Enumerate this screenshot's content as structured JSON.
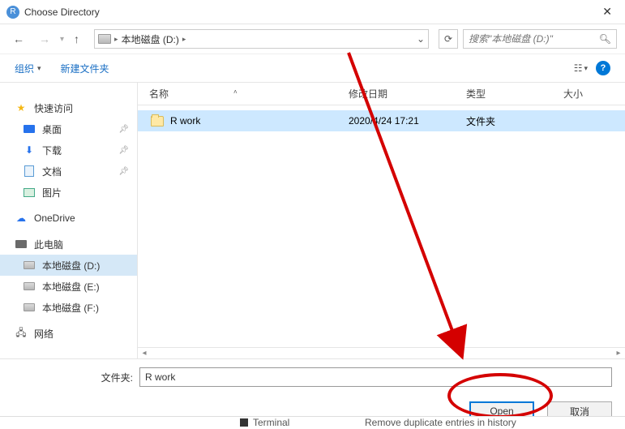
{
  "title": "Choose Directory",
  "breadcrumb": {
    "drive_label": "本地磁盘 (D:)"
  },
  "search": {
    "placeholder": "搜索\"本地磁盘 (D:)\""
  },
  "toolbar": {
    "organize": "组织",
    "newfolder": "新建文件夹"
  },
  "columns": {
    "name": "名称",
    "date": "修改日期",
    "type": "类型",
    "size": "大小"
  },
  "sidebar": {
    "quick": "快速访问",
    "desktop": "桌面",
    "downloads": "下载",
    "documents": "文档",
    "pictures": "图片",
    "onedrive": "OneDrive",
    "thispc": "此电脑",
    "drive_d": "本地磁盘 (D:)",
    "drive_e": "本地磁盘 (E:)",
    "drive_f": "本地磁盘 (F:)",
    "network": "网络"
  },
  "rows": [
    {
      "name": "R work",
      "date": "2020/4/24 17:21",
      "type": "文件夹"
    }
  ],
  "footer": {
    "label": "文件夹:",
    "value": "R work",
    "open": "Open",
    "cancel": "取消"
  },
  "bleed": {
    "terminal": "Terminal",
    "remove": "Remove duplicate entries in history"
  }
}
